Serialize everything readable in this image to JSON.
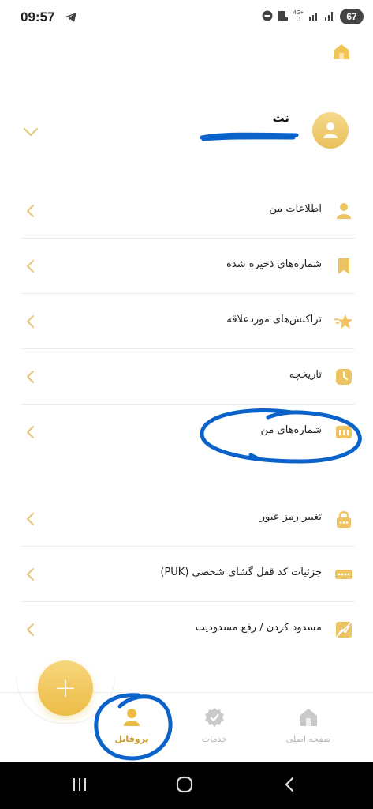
{
  "status_bar": {
    "time": "09:57",
    "battery": "67",
    "network": "4G+"
  },
  "profile": {
    "name": "نت"
  },
  "menu": {
    "items": [
      {
        "label": "اطلاعات من",
        "icon": "person-icon"
      },
      {
        "label": "شماره‌های ذخیره شده",
        "icon": "bookmark-icon"
      },
      {
        "label": "تراکنش‌های موردعلاقه",
        "icon": "star-icon"
      },
      {
        "label": "تاریخچه",
        "icon": "clock-icon"
      },
      {
        "label": "شماره‌های من",
        "icon": "sim-card-icon"
      },
      {
        "label": "تغییر رمز عبور",
        "icon": "lock-icon"
      },
      {
        "label": "جزئیات کد قفل گشای شخصی (PUK)",
        "icon": "password-dots-icon"
      },
      {
        "label": "مسدود کردن / رفع مسدودیت",
        "icon": "block-chart-icon"
      }
    ]
  },
  "fab": {
    "label": "+"
  },
  "bottom_nav": {
    "home": "صفحه اصلی",
    "services": "خدمات",
    "profile": "پروفایل"
  },
  "colors": {
    "accent": "#ecbc45",
    "accent_light": "#f6d98b",
    "annotation": "#0b63c9",
    "inactive": "#b5b5b5"
  }
}
